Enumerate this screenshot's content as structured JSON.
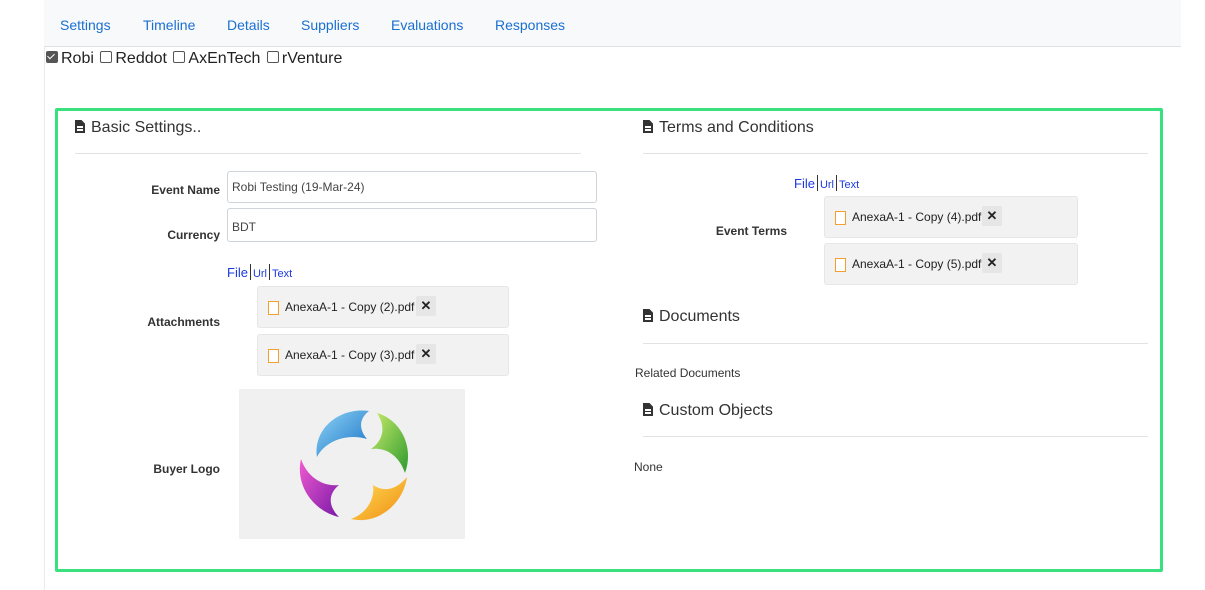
{
  "tabs": [
    "Settings",
    "Timeline",
    "Details",
    "Suppliers",
    "Evaluations",
    "Responses"
  ],
  "suppliers": [
    {
      "name": "Robi",
      "checked": true
    },
    {
      "name": "Reddot",
      "checked": false
    },
    {
      "name": "AxEnTech",
      "checked": false
    },
    {
      "name": "rVenture",
      "checked": false
    }
  ],
  "basic": {
    "title": "Basic Settings..",
    "event_name_label": "Event Name",
    "event_name_value": "Robi Testing (19-Mar-24)",
    "currency_label": "Currency",
    "currency_value": "BDT",
    "file_tab": "File",
    "url_tab": "Url",
    "text_tab": "Text",
    "attachments_label": "Attachments",
    "attachments": [
      "AnexaA-1 - Copy (2).pdf",
      "AnexaA-1 - Copy (3).pdf"
    ],
    "remove_glyph": "✕",
    "buyer_logo_label": "Buyer Logo"
  },
  "terms": {
    "title": "Terms and Conditions",
    "file_tab": "File",
    "url_tab": "Url",
    "text_tab": "Text",
    "event_terms_label": "Event Terms",
    "files": [
      "AnexaA-1 - Copy (4).pdf",
      "AnexaA-1 - Copy (5).pdf"
    ]
  },
  "documents": {
    "title": "Documents",
    "related_label": "Related Documents"
  },
  "custom_objects": {
    "title": "Custom Objects",
    "value": "None"
  },
  "colors": {
    "frame": "#38e07e",
    "tab_link": "#1a6fd1",
    "file_tab_link": "#1a39e0",
    "file_icon": "#f0a030"
  }
}
